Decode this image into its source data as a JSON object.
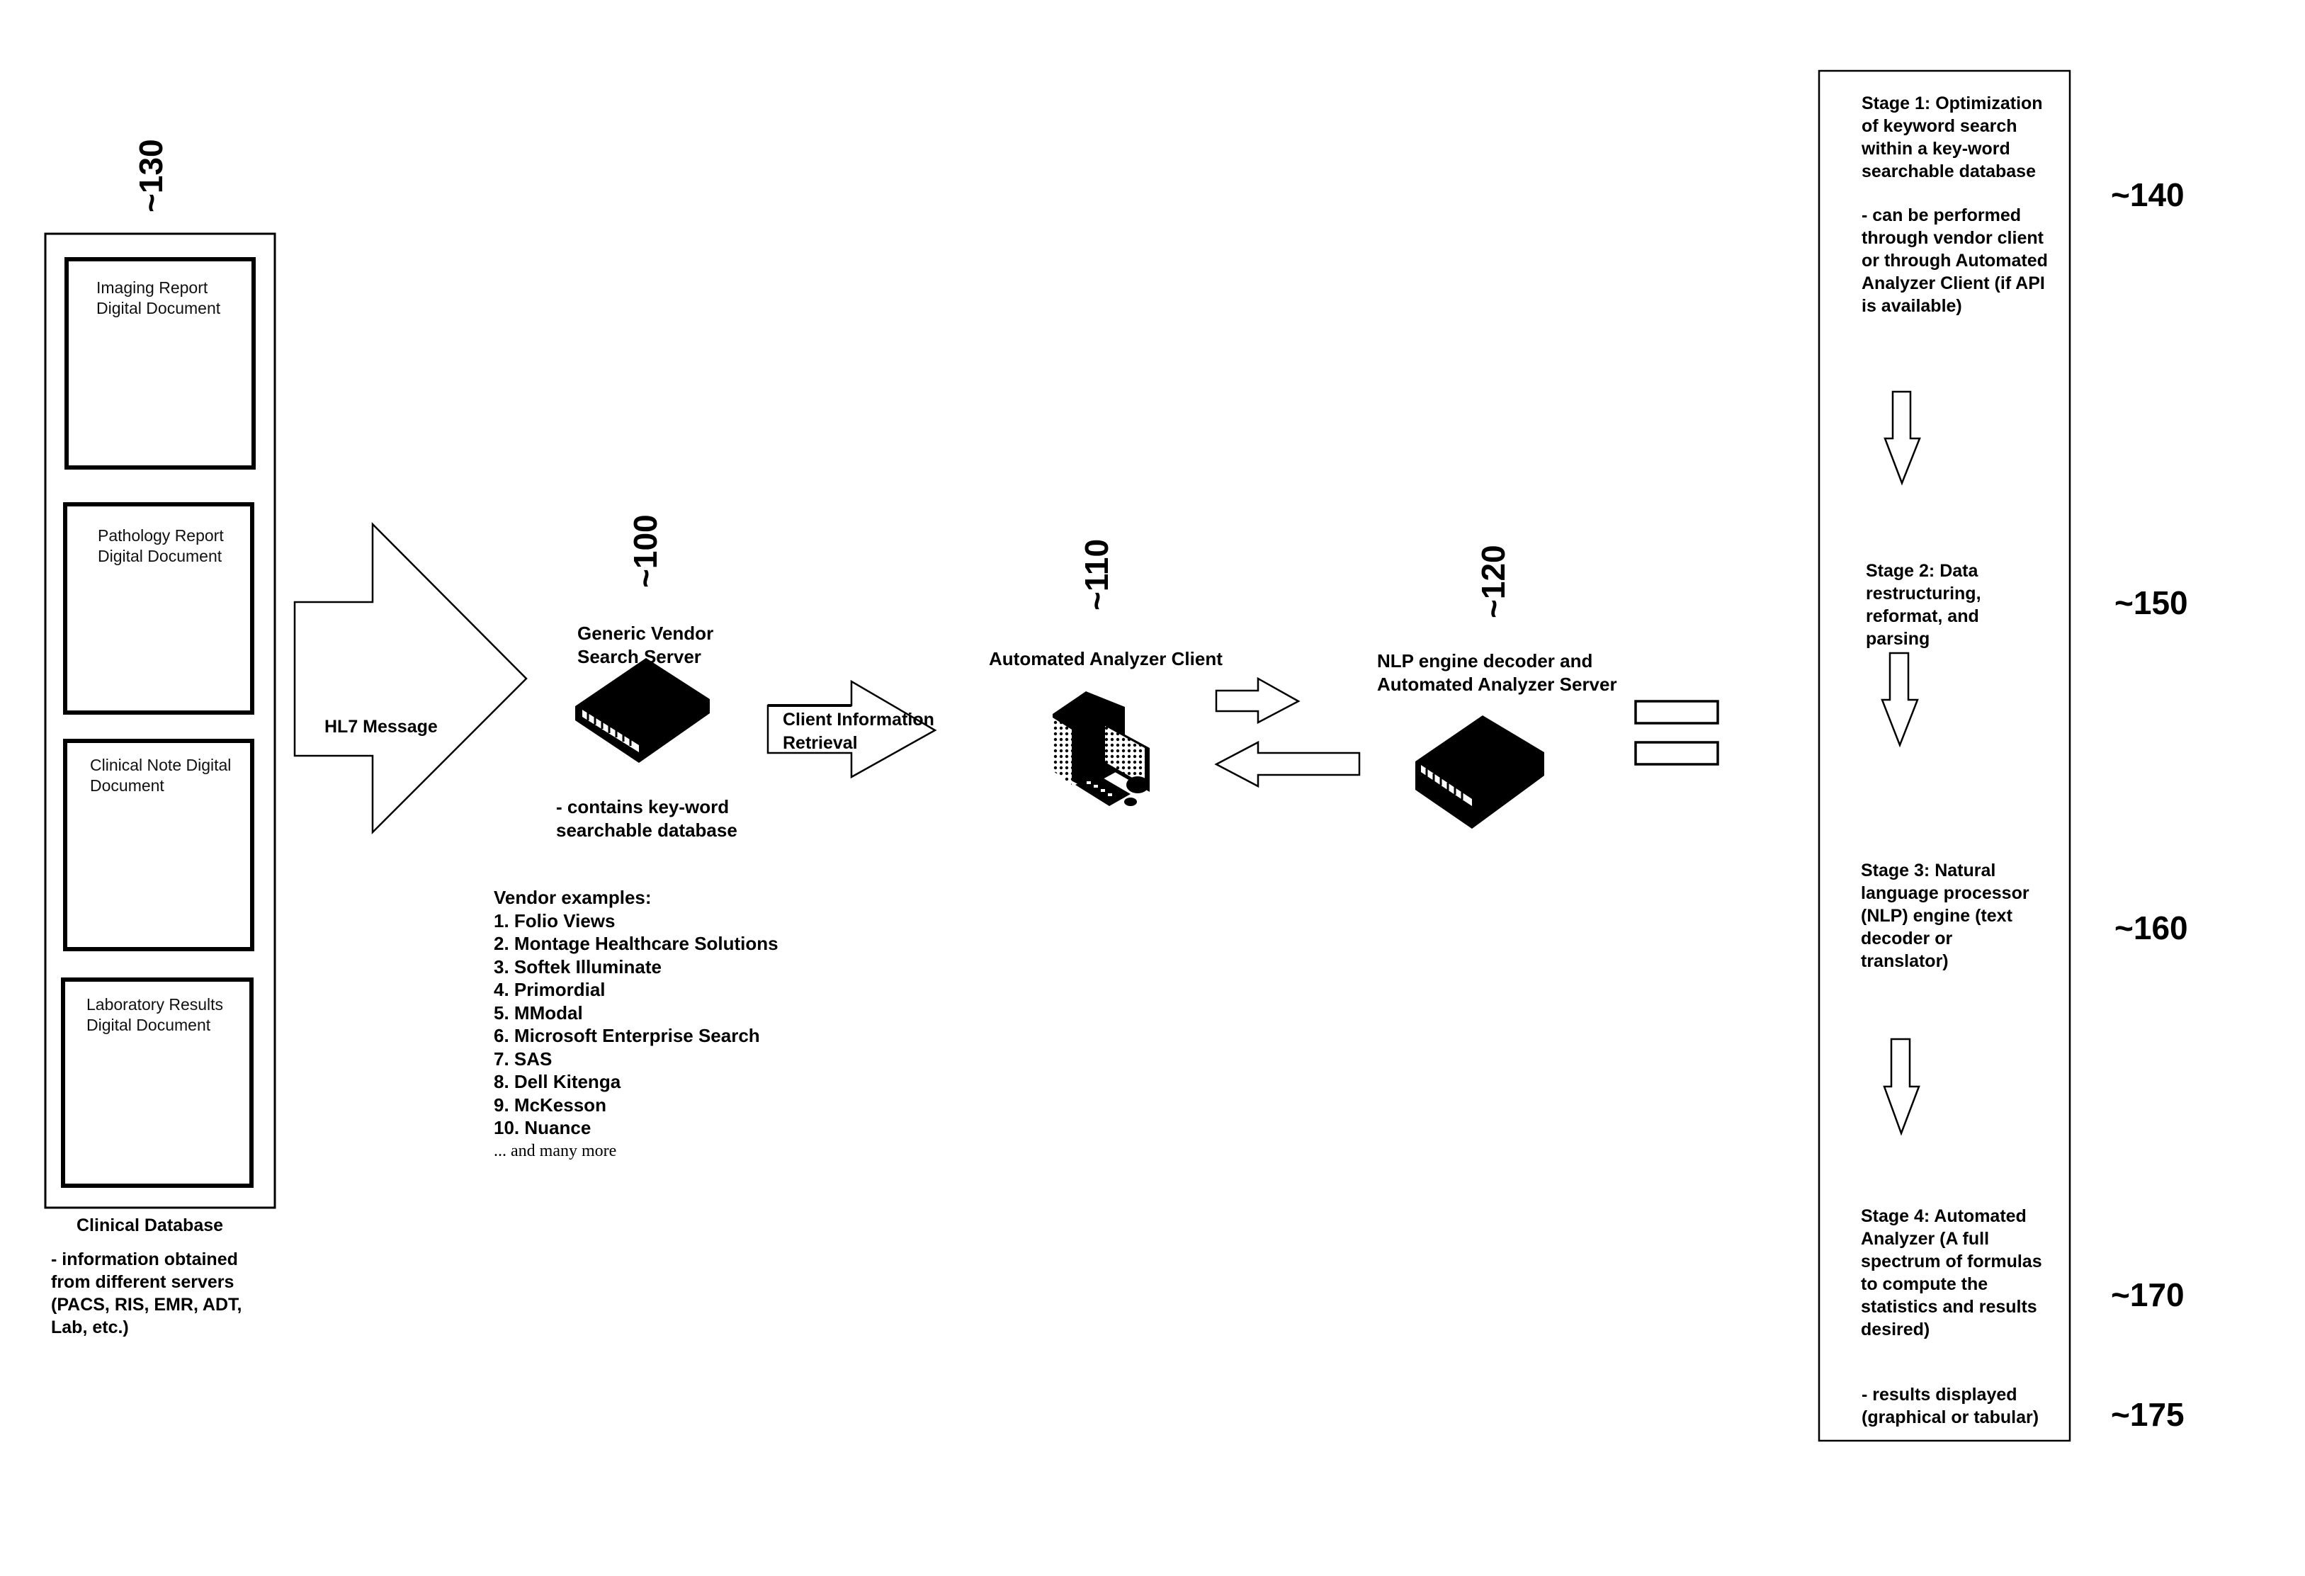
{
  "diagram": {
    "clinical_database": {
      "ref": "~130",
      "title": "Clinical Database",
      "documents": [
        {
          "label": "Imaging Report Digital Document"
        },
        {
          "label": "Pathology Report Digital Document"
        },
        {
          "label": "Clinical Note Digital Document"
        },
        {
          "label": "Laboratory Results Digital Document"
        }
      ],
      "note": "- information obtained from different servers (PACS, RIS, EMR, ADT, Lab, etc.)"
    },
    "hl7_arrow": {
      "label": "HL7 Message"
    },
    "vendor_server": {
      "ref": "~100",
      "title": "Generic Vendor Search Server",
      "note": "- contains key-word searchable database",
      "icon": "server-icon",
      "vendor_heading": "Vendor examples:",
      "vendors": [
        "1. Folio Views",
        "2. Montage Healthcare Solutions",
        "3. Softek Illuminate",
        "4. Primordial",
        "5. MModal",
        "6. Microsoft Enterprise Search",
        "7. SAS",
        "8. Dell Kitenga",
        "9. McKesson",
        "10. Nuance"
      ],
      "vendors_more": "... and many more"
    },
    "client_arrow": {
      "label": "Client Information Retrieval"
    },
    "analyzer_client": {
      "ref": "~110",
      "title": "Automated Analyzer Client",
      "icon": "desktop-computer-icon"
    },
    "nlp_server": {
      "ref": "~120",
      "title": "NLP engine decoder and Automated Analyzer Server",
      "icon": "server-icon"
    },
    "equals_sign": {
      "icon": "equals-icon"
    },
    "stages": [
      {
        "ref": "~140",
        "text": "Stage 1: Optimization of keyword search within a key-word searchable database",
        "note": "- can be performed through vendor client or through Automated Analyzer Client (if API is available)"
      },
      {
        "ref": "~150",
        "text": "Stage 2: Data restructuring, reformat, and parsing",
        "note": ""
      },
      {
        "ref": "~160",
        "text": "Stage 3: Natural language processor (NLP) engine (text decoder or translator)",
        "note": ""
      },
      {
        "ref": "~170",
        "text": "Stage 4: Automated Analyzer (A full spectrum of formulas to compute the statistics and results desired)",
        "note": ""
      }
    ],
    "results_note": {
      "ref": "~175",
      "text": "- results displayed (graphical or tabular)"
    }
  }
}
